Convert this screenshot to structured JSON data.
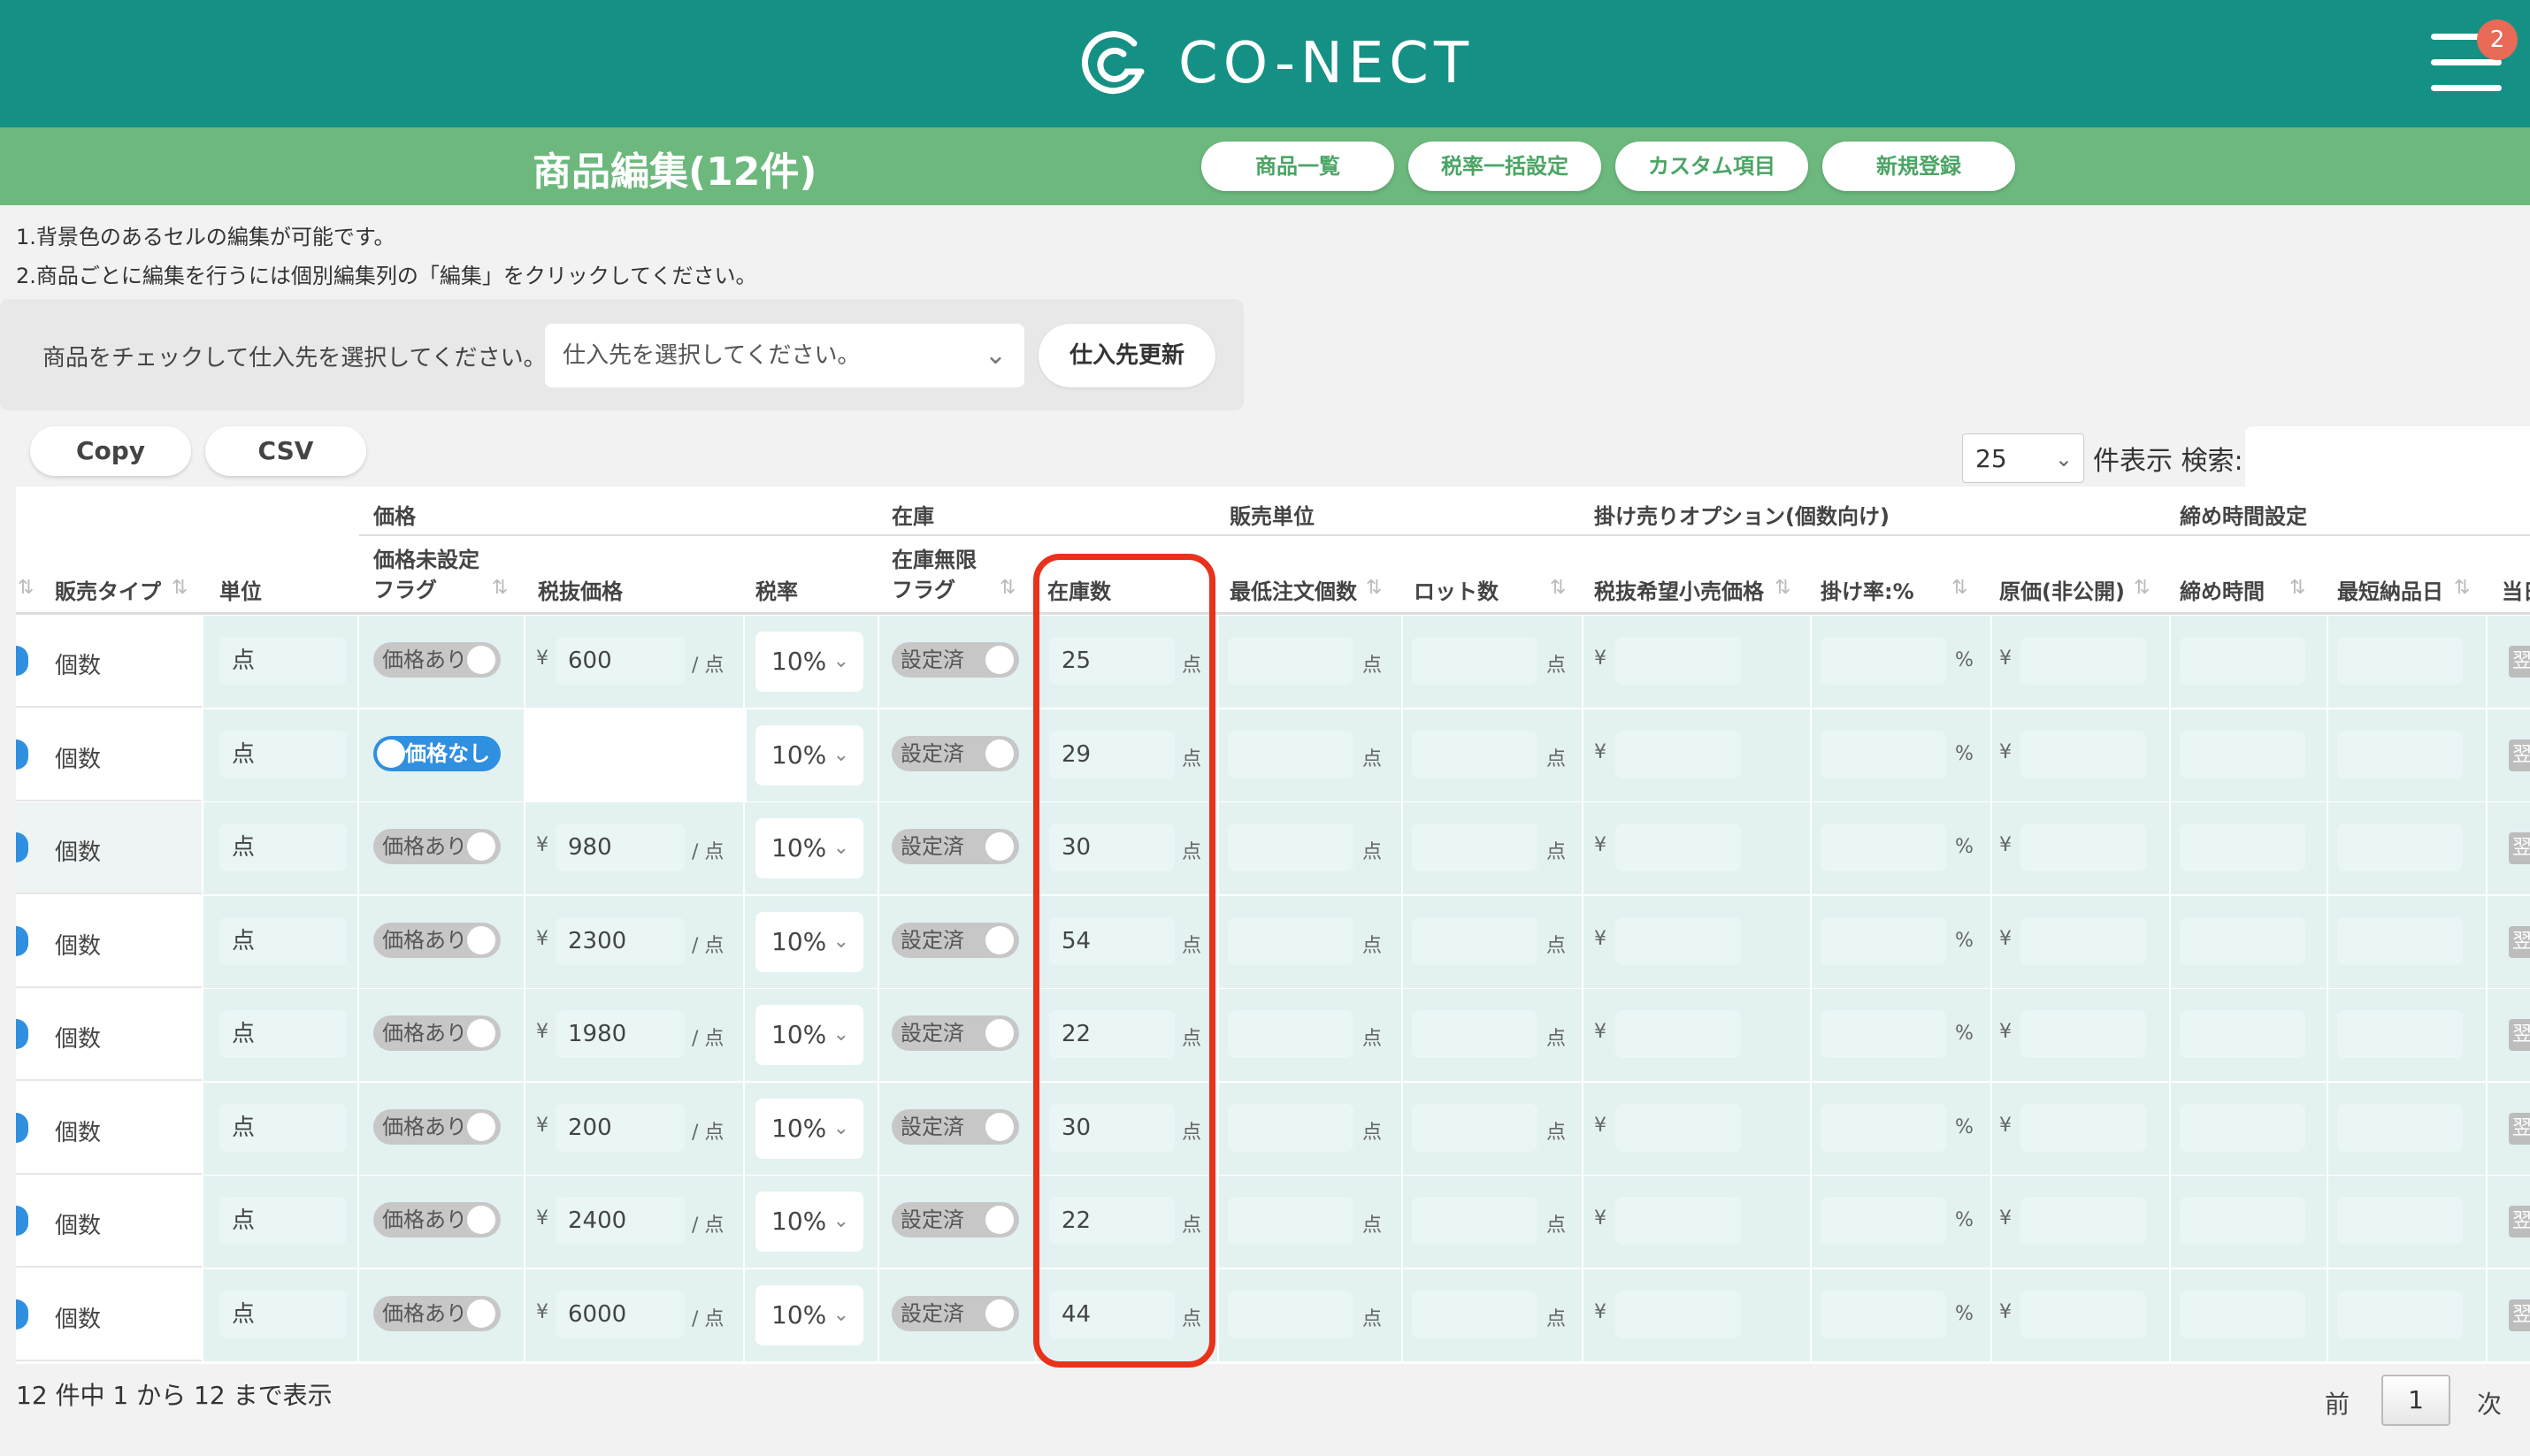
{
  "header": {
    "brand": "CO-NECT",
    "notification_count": "2",
    "colors": {
      "topbar": "#159084",
      "subbar": "#6cb87d",
      "highlight": "#e8321b",
      "toggle_on": "#2f8fe0"
    }
  },
  "page": {
    "title": "商品編集(12件)",
    "nav": [
      "商品一覧",
      "税率一括設定",
      "カスタム項目",
      "新規登録"
    ]
  },
  "notes": [
    "1.背景色のあるセルの編集が可能です。",
    "2.商品ごとに編集を行うには個別編集列の「編集」をクリックしてください。"
  ],
  "supplier": {
    "label": "商品をチェックして仕入先を選択してください。",
    "placeholder": "仕入先を選択してください。",
    "button": "仕入先更新"
  },
  "tools": {
    "copy": "Copy",
    "csv": "CSV"
  },
  "table_controls": {
    "page_length": "25",
    "length_label": "件表示",
    "search_label": "検索:"
  },
  "groups": {
    "price": "価格",
    "stock": "在庫",
    "sales_unit": "販売単位",
    "credit_option": "掛け売りオプション(個数向け)",
    "deadline": "締め時間設定"
  },
  "columns": {
    "sales_type": "販売タイプ",
    "unit": "単位",
    "price_flag_1": "価格未設定",
    "price_flag_2": "フラグ",
    "price_ex_tax": "税抜価格",
    "tax_rate": "税率",
    "unlimited_1": "在庫無限",
    "unlimited_2": "フラグ",
    "stock_count": "在庫数",
    "min_order": "最低注文個数",
    "lot": "ロット数",
    "msrp": "税抜希望小売価格",
    "rate": "掛け率:%",
    "cost": "原価(非公開)",
    "deadline_time": "締め時間",
    "shortest_delivery": "最短納品日",
    "cut_header": "当日"
  },
  "labels": {
    "currency": "¥",
    "per_unit": "/ 点",
    "unit_point": "点",
    "percent": "%",
    "cut_cell": "翌"
  },
  "rows": [
    {
      "sales_type": "個数",
      "unit": "点",
      "price_flag": "価格あり",
      "price": "600",
      "tax": "10%",
      "unlimited": "設定済",
      "stock": "25"
    },
    {
      "sales_type": "個数",
      "unit": "点",
      "price_flag": "価格なし",
      "price": "",
      "tax": "10%",
      "unlimited": "設定済",
      "stock": "29"
    },
    {
      "sales_type": "個数",
      "unit": "点",
      "price_flag": "価格あり",
      "price": "980",
      "tax": "10%",
      "unlimited": "設定済",
      "stock": "30"
    },
    {
      "sales_type": "個数",
      "unit": "点",
      "price_flag": "価格あり",
      "price": "2300",
      "tax": "10%",
      "unlimited": "設定済",
      "stock": "54"
    },
    {
      "sales_type": "個数",
      "unit": "点",
      "price_flag": "価格あり",
      "price": "1980",
      "tax": "10%",
      "unlimited": "設定済",
      "stock": "22"
    },
    {
      "sales_type": "個数",
      "unit": "点",
      "price_flag": "価格あり",
      "price": "200",
      "tax": "10%",
      "unlimited": "設定済",
      "stock": "30"
    },
    {
      "sales_type": "個数",
      "unit": "点",
      "price_flag": "価格あり",
      "price": "2400",
      "tax": "10%",
      "unlimited": "設定済",
      "stock": "22"
    },
    {
      "sales_type": "個数",
      "unit": "点",
      "price_flag": "価格あり",
      "price": "6000",
      "tax": "10%",
      "unlimited": "設定済",
      "stock": "44"
    }
  ],
  "footer": {
    "info": "12 件中 1 から 12 まで表示",
    "prev": "前",
    "current": "1",
    "next": "次"
  }
}
